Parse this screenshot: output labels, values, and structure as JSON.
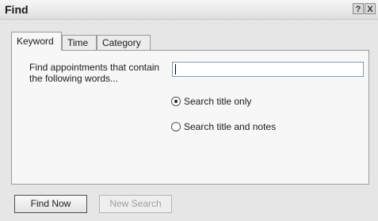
{
  "window": {
    "title": "Find"
  },
  "titlebar": {
    "help_label": "?",
    "close_label": "X"
  },
  "tabs": [
    {
      "label": "Keyword",
      "active": true
    },
    {
      "label": "Time",
      "active": false
    },
    {
      "label": "Category",
      "active": false
    }
  ],
  "keyword_tab": {
    "find_label": "Find appointments that contain the following words...",
    "search_value": "",
    "options": [
      {
        "label": "Search title only",
        "checked": true
      },
      {
        "label": "Search title and notes",
        "checked": false
      }
    ]
  },
  "buttons": {
    "find_now": "Find Now",
    "new_search": "New Search"
  }
}
